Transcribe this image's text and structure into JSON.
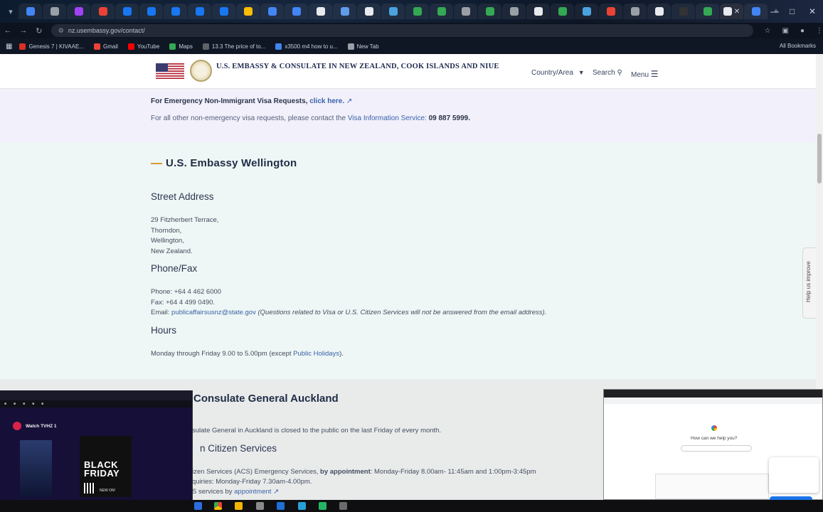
{
  "browser": {
    "url": "nz.usembassy.gov/contact/",
    "bookmarks": [
      {
        "label": "Genesis 7 | KIVAAE...",
        "color": "#d93025"
      },
      {
        "label": "Gmail",
        "color": "#ea4335"
      },
      {
        "label": "YouTube",
        "color": "#ff0000"
      },
      {
        "label": "Maps",
        "color": "#34a853"
      },
      {
        "label": "13.3 The price of to...",
        "color": "#5f6368"
      },
      {
        "label": "x3500 m4 how to u...",
        "color": "#4285f4"
      },
      {
        "label": "New Tab",
        "color": "#9aa0a6"
      }
    ],
    "all_bookmarks": "All Bookmarks",
    "tab_count": 31
  },
  "header": {
    "site_title": "U.S. EMBASSY & CONSULATE IN NEW ZEALAND, COOK ISLANDS AND NIUE",
    "country_area": "Country/Area",
    "search": "Search",
    "menu": "Menu"
  },
  "emergency": {
    "line1_text": "For Emergency Non-Immigrant Visa Requests, ",
    "line1_link": "click here.",
    "line2_text": "For all other non-emergency visa requests, please contact the ",
    "line2_link": "Visa Information Service",
    "line2_sep": ": ",
    "phone": "09 887 5999."
  },
  "wellington": {
    "title": "U.S. Embassy Wellington",
    "street_heading": "Street Address",
    "address": [
      "29 Fitzherbert Terrace,",
      "Thorndon,",
      "Wellington,",
      "New Zealand."
    ],
    "phone_heading": "Phone/Fax",
    "phone": "Phone: +64 4 462 6000",
    "fax": "Fax: +64 4 499 0490.",
    "email_label": "Email: ",
    "email": "publicaffairsusnz@state.gov",
    "email_note": " (Questions related to Visa or U.S. Citizen Services will not be answered from the email address).",
    "hours_heading": "Hours",
    "hours_text": "Monday through Friday 9.00 to 5.00pm (except ",
    "hours_link": "Public Holidays",
    "hours_end": ")."
  },
  "auckland": {
    "title": "Consulate General Auckland",
    "closed_note": "sulate General in Auckland is closed to the public on the last Friday of every month.",
    "citizen_heading": "n Citizen Services",
    "acs_text": "izen Services (ACS) Emergency Services, ",
    "acs_bold": "by appointment",
    "acs_hours": ": Monday-Friday 8.00am- 11:45am and 1:00pm-3:45pm",
    "enquiries": "quiries: Monday-Friday 7.30am-4.00pm.",
    "services_text": "S services by ",
    "services_link": "appointment"
  },
  "help_tab": "Help us improve",
  "pip_left": {
    "watch": "Watch TVHZ 1",
    "promo_line1": "BLACK",
    "promo_line2": "FRIDAY",
    "promo_tag": "NEW ON!"
  },
  "pip_right": {
    "question": "How can we help you?"
  }
}
